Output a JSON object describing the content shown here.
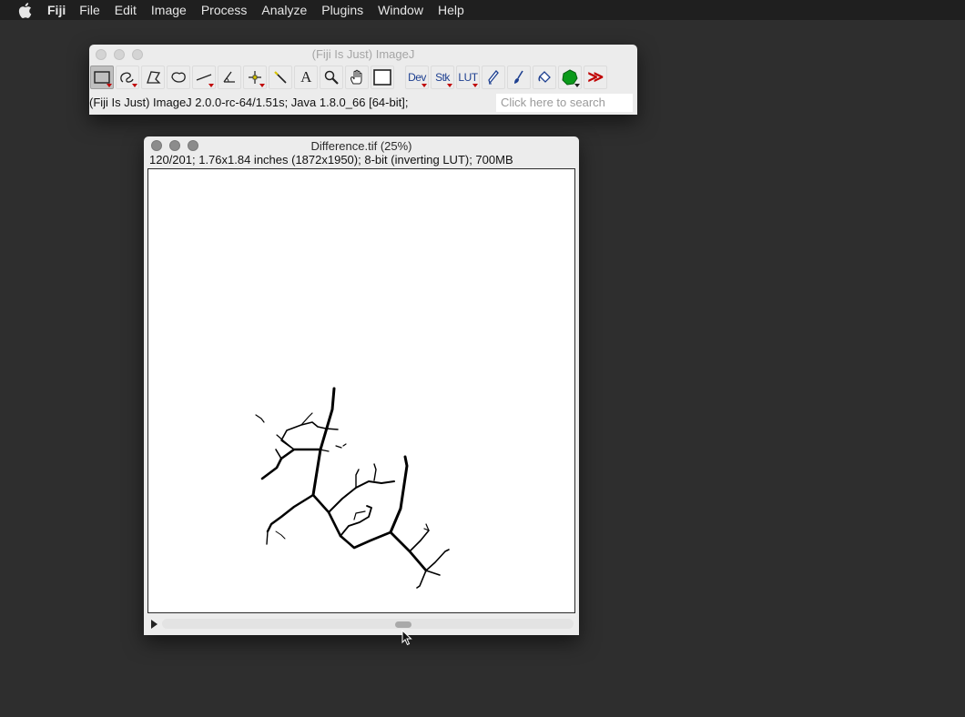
{
  "menubar": {
    "app": "Fiji",
    "items": [
      "File",
      "Edit",
      "Image",
      "Process",
      "Analyze",
      "Plugins",
      "Window",
      "Help"
    ]
  },
  "imagej_window": {
    "title": "(Fiji Is Just) ImageJ",
    "tools": {
      "rectangle": "rectangle-selection-icon",
      "freehand": "freehand-selection-icon",
      "polygon": "polygon-selection-icon",
      "oval": "oval-selection-icon",
      "line": "line-selection-icon",
      "angle": "angle-icon",
      "point": "point-tool-icon",
      "wand": "wand-icon",
      "text": "A",
      "magnifier": "magnifier-icon",
      "hand": "hand-icon",
      "color_picker": "color-picker-icon",
      "dev": "Dev",
      "stk": "Stk",
      "lut": "LUT",
      "pencil": "pencil-icon",
      "brush": "brush-icon",
      "flood_fill": "flood-fill-icon",
      "green_blob": "green-blob-icon",
      "more": "≫"
    },
    "status": "(Fiji Is Just) ImageJ 2.0.0-rc-64/1.51s; Java 1.8.0_66 [64-bit];",
    "search_placeholder": "Click here to search"
  },
  "image_window": {
    "title": "Difference.tif (25%)",
    "info": "120/201; 1.76x1.84 inches (1872x1950); 8-bit (inverting LUT); 700MB"
  },
  "colors": {
    "desktop": "#2e2e2e",
    "menubar": "#1f1f1f",
    "window": "#ececec",
    "tool_text": "#1d3f90",
    "accent_red": "#c00000",
    "green_blob": "#0a9a1a"
  }
}
